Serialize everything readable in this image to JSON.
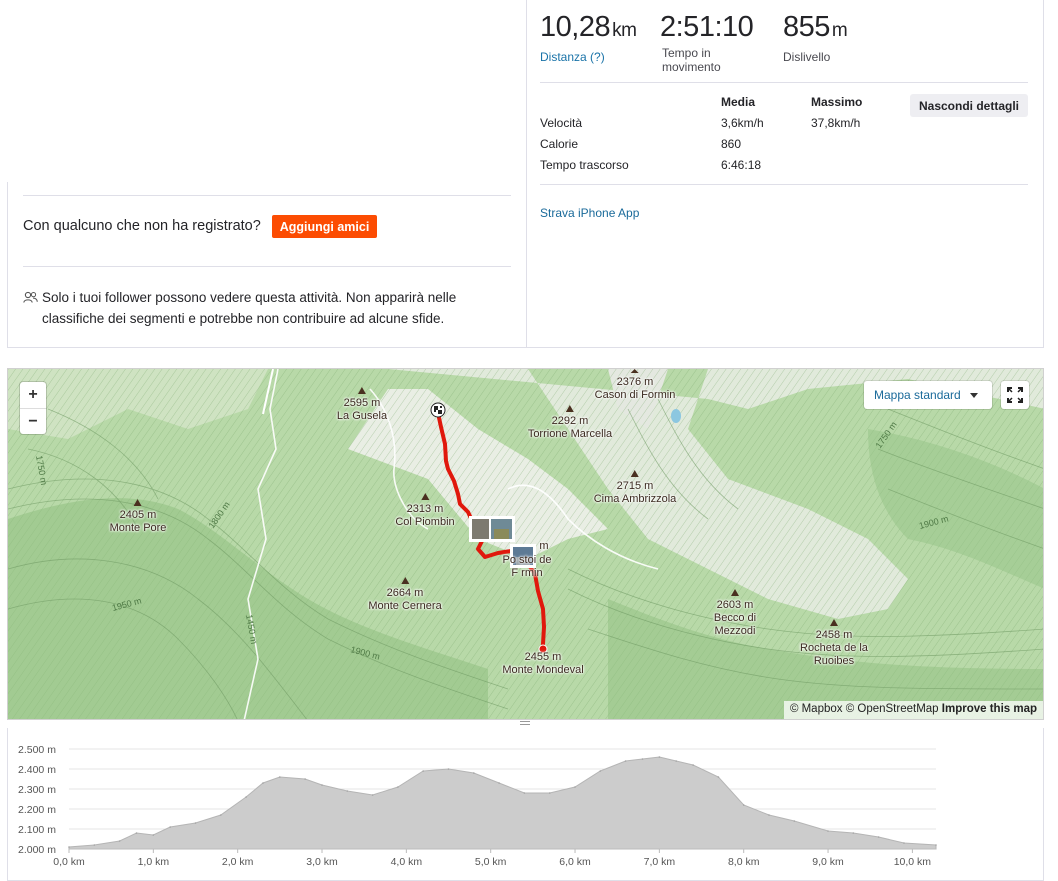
{
  "stats": {
    "distance": {
      "value": "10,28",
      "unit": "km",
      "label": "Distanza (?)"
    },
    "moving_time": {
      "value": "2:51:10",
      "label_line1": "Tempo in",
      "label_line2": "movimento"
    },
    "elevation": {
      "value": "855",
      "unit": "m",
      "label": "Dislivello"
    }
  },
  "details": {
    "header_avg": "Media",
    "header_max": "Massimo",
    "hide_button": "Nascondi dettagli",
    "rows": [
      {
        "label": "Velocità",
        "avg": "3,6km/h",
        "max": "37,8km/h"
      },
      {
        "label": "Calorie",
        "avg": "860",
        "max": ""
      },
      {
        "label": "Tempo trascorso",
        "avg": "6:46:18",
        "max": ""
      }
    ],
    "device": "Strava iPhone App"
  },
  "friends": {
    "question": "Con qualcuno che non ha registrato?",
    "button": "Aggiungi amici"
  },
  "privacy": {
    "icon": "users-icon",
    "text": "Solo i tuoi follower possono vedere questa attività. Non apparirà nelle classifiche dei segmenti e potrebbe non contribuire ad alcune sfide."
  },
  "map": {
    "zoom_in": "+",
    "zoom_out": "−",
    "style": "Mappa standard",
    "attribution_1": "© Mapbox © OpenStreetMap",
    "attribution_2": "Improve this map",
    "route_color": "#e0180c",
    "peaks": [
      {
        "alt": "2595 m",
        "name": "La Gusela"
      },
      {
        "alt": "2376 m",
        "name": "Cason di Formin"
      },
      {
        "alt": "2292 m",
        "name": "Torrione Marcella"
      },
      {
        "alt": "2405 m",
        "name": "Monte Pore"
      },
      {
        "alt": "2313 m",
        "name": "Col Piombin"
      },
      {
        "alt": "2715 m",
        "name": "Cima Ambrizzola"
      },
      {
        "alt": "m",
        "name": "Po    stoi de F   rmin"
      },
      {
        "alt": "2664 m",
        "name": "Monte Cernera"
      },
      {
        "alt": "2603 m",
        "name": "Becco di Mezzodi"
      },
      {
        "alt": "2458 m",
        "name": "Rocheta de la Ruoibes"
      },
      {
        "alt": "2455 m",
        "name": "Monte Mondeval"
      }
    ],
    "contours": [
      "1750 m",
      "1800 m",
      "1950 m",
      "1450 m",
      "1900 m",
      "1750 m",
      "1900 m"
    ]
  },
  "chart_data": {
    "type": "area",
    "title": "",
    "xlabel": "",
    "ylabel": "",
    "xlim": [
      0,
      10.28
    ],
    "ylim": [
      2000,
      2500
    ],
    "ytick_labels": [
      "2.500 m",
      "2.400 m",
      "2.300 m",
      "2.200 m",
      "2.100 m",
      "2.000 m"
    ],
    "xtick_labels": [
      "0,0 km",
      "1,0 km",
      "2,0 km",
      "3,0 km",
      "4,0 km",
      "5,0 km",
      "6,0 km",
      "7,0 km",
      "8,0 km",
      "9,0 km",
      "10,0 km"
    ],
    "fill_color": "#cccccc",
    "x": [
      0,
      0.3,
      0.6,
      0.8,
      1.0,
      1.2,
      1.5,
      1.8,
      2.1,
      2.3,
      2.5,
      2.8,
      3.0,
      3.3,
      3.6,
      3.9,
      4.2,
      4.5,
      4.8,
      5.1,
      5.4,
      5.7,
      6.0,
      6.3,
      6.6,
      6.8,
      7.0,
      7.2,
      7.4,
      7.7,
      8.0,
      8.3,
      8.6,
      9.0,
      9.3,
      9.6,
      9.9,
      10.28
    ],
    "y": [
      2010,
      2020,
      2040,
      2080,
      2070,
      2110,
      2130,
      2170,
      2260,
      2330,
      2360,
      2350,
      2320,
      2290,
      2270,
      2310,
      2390,
      2400,
      2380,
      2330,
      2280,
      2280,
      2310,
      2390,
      2440,
      2450,
      2460,
      2440,
      2420,
      2360,
      2220,
      2170,
      2140,
      2090,
      2080,
      2060,
      2030,
      2020
    ]
  }
}
